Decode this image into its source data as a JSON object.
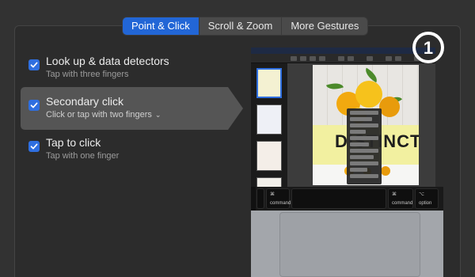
{
  "tabs": [
    "Point & Click",
    "Scroll & Zoom",
    "More Gestures"
  ],
  "active_tab": "Point & Click",
  "options": [
    {
      "title": "Look up & data detectors",
      "subtitle": "Tap with three fingers",
      "checked": true
    },
    {
      "title": "Secondary click",
      "subtitle": "Click or tap with two fingers",
      "checked": true,
      "has_dropdown": true
    },
    {
      "title": "Tap to click",
      "subtitle": "Tap with one finger",
      "checked": true
    }
  ],
  "preview": {
    "document_word": "DISTINCT",
    "keyboard": {
      "left_command": {
        "symbol": "⌘",
        "label": "command"
      },
      "right_command": {
        "symbol": "⌘",
        "label": "command"
      },
      "option": {
        "symbol": "⌥",
        "label": "option"
      }
    }
  },
  "logo": {
    "text": "1"
  },
  "colors": {
    "accent": "#2266d6",
    "checkbox": "#2f6fe0",
    "background": "#323232",
    "highlight": "#555555"
  }
}
